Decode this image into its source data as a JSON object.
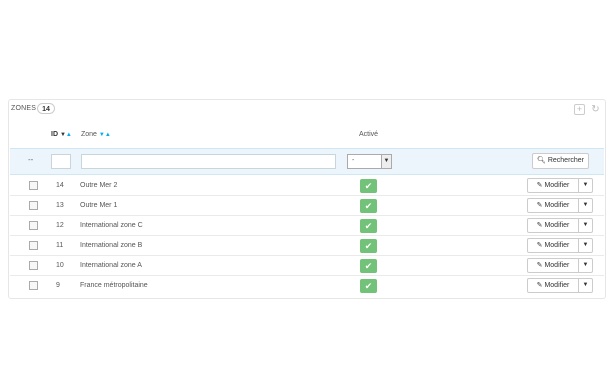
{
  "panel": {
    "title": "ZONES",
    "count": "14",
    "add_icon": "plus-square-icon",
    "refresh_icon": "refresh-icon"
  },
  "columns": {
    "id": "ID",
    "zone": "Zone",
    "active": "Activé"
  },
  "filters": {
    "bulk_placeholder": "--",
    "active_value": "-",
    "search_label": "Rechercher"
  },
  "rows": [
    {
      "id": "14",
      "name": "Outre Mer 2",
      "edit": "Modifier"
    },
    {
      "id": "13",
      "name": "Outre Mer 1",
      "edit": "Modifier"
    },
    {
      "id": "12",
      "name": "International zone C",
      "edit": "Modifier"
    },
    {
      "id": "11",
      "name": "International zone B",
      "edit": "Modifier"
    },
    {
      "id": "10",
      "name": "International zone A",
      "edit": "Modifier"
    },
    {
      "id": "9",
      "name": "France métropolitaine",
      "edit": "Modifier"
    }
  ],
  "colors": {
    "active_green": "#72c279",
    "filter_bg": "#ebf5fb",
    "sort_accent": "#00aff0"
  }
}
